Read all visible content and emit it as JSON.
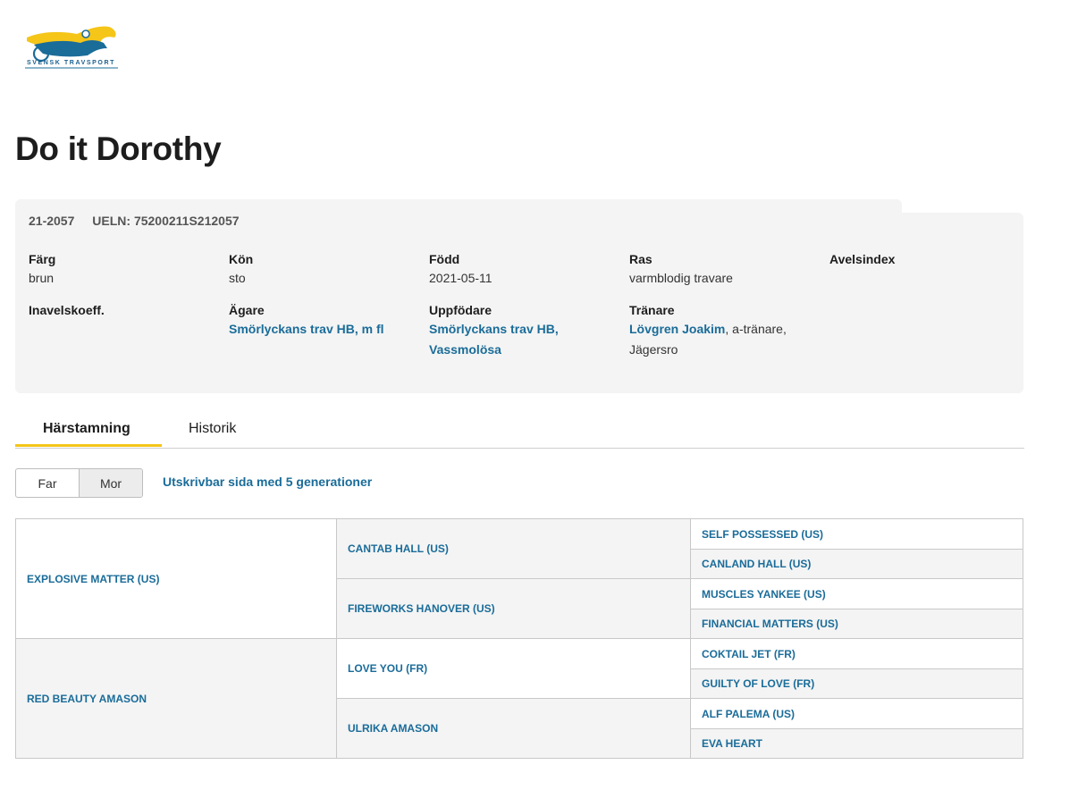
{
  "brand": {
    "logo_text": "SVENSK TRAVSPORT"
  },
  "horse": {
    "name": "Do it Dorothy",
    "reg_no": "21-2057",
    "ueln": "UELN: 75200211S212057"
  },
  "info": {
    "farg_label": "Färg",
    "farg_value": "brun",
    "kon_label": "Kön",
    "kon_value": "sto",
    "fodd_label": "Född",
    "fodd_value": "2021-05-11",
    "ras_label": "Ras",
    "ras_value": "varmblodig travare",
    "avelsindex_label": "Avelsindex",
    "inavel_label": "Inavelskoeff.",
    "agare_label": "Ägare",
    "agare_value": "Smörlyckans trav HB, m fl",
    "uppfodare_label": "Uppfödare",
    "uppfodare_line1": "Smörlyckans trav HB,",
    "uppfodare_line2": "Vassmolösa",
    "tranare_label": "Tränare",
    "tranare_name": "Lövgren Joakim",
    "tranare_suffix": ", a-tränare,",
    "tranare_place": "Jägersro"
  },
  "tabs": [
    {
      "label": "Härstamning",
      "active": true
    },
    {
      "label": "Historik",
      "active": false
    }
  ],
  "toggle": {
    "far": "Far",
    "mor": "Mor",
    "selected": "Mor"
  },
  "print_link": "Utskrivbar sida med 5 generationer",
  "pedigree": {
    "gen1": [
      "EXPLOSIVE MATTER (US)",
      "RED BEAUTY AMASON"
    ],
    "gen2": [
      "CANTAB HALL (US)",
      "FIREWORKS HANOVER (US)",
      "LOVE YOU (FR)",
      "ULRIKA AMASON"
    ],
    "gen3": [
      "SELF POSSESSED (US)",
      "CANLAND HALL (US)",
      "MUSCLES YANKEE (US)",
      "FINANCIAL MATTERS (US)",
      "COKTAIL JET (FR)",
      "GUILTY OF LOVE (FR)",
      "ALF PALEMA (US)",
      "EVA HEART"
    ]
  },
  "colors": {
    "link": "#1a6c99",
    "accent": "#f5c518",
    "panel": "#f4f4f4"
  }
}
